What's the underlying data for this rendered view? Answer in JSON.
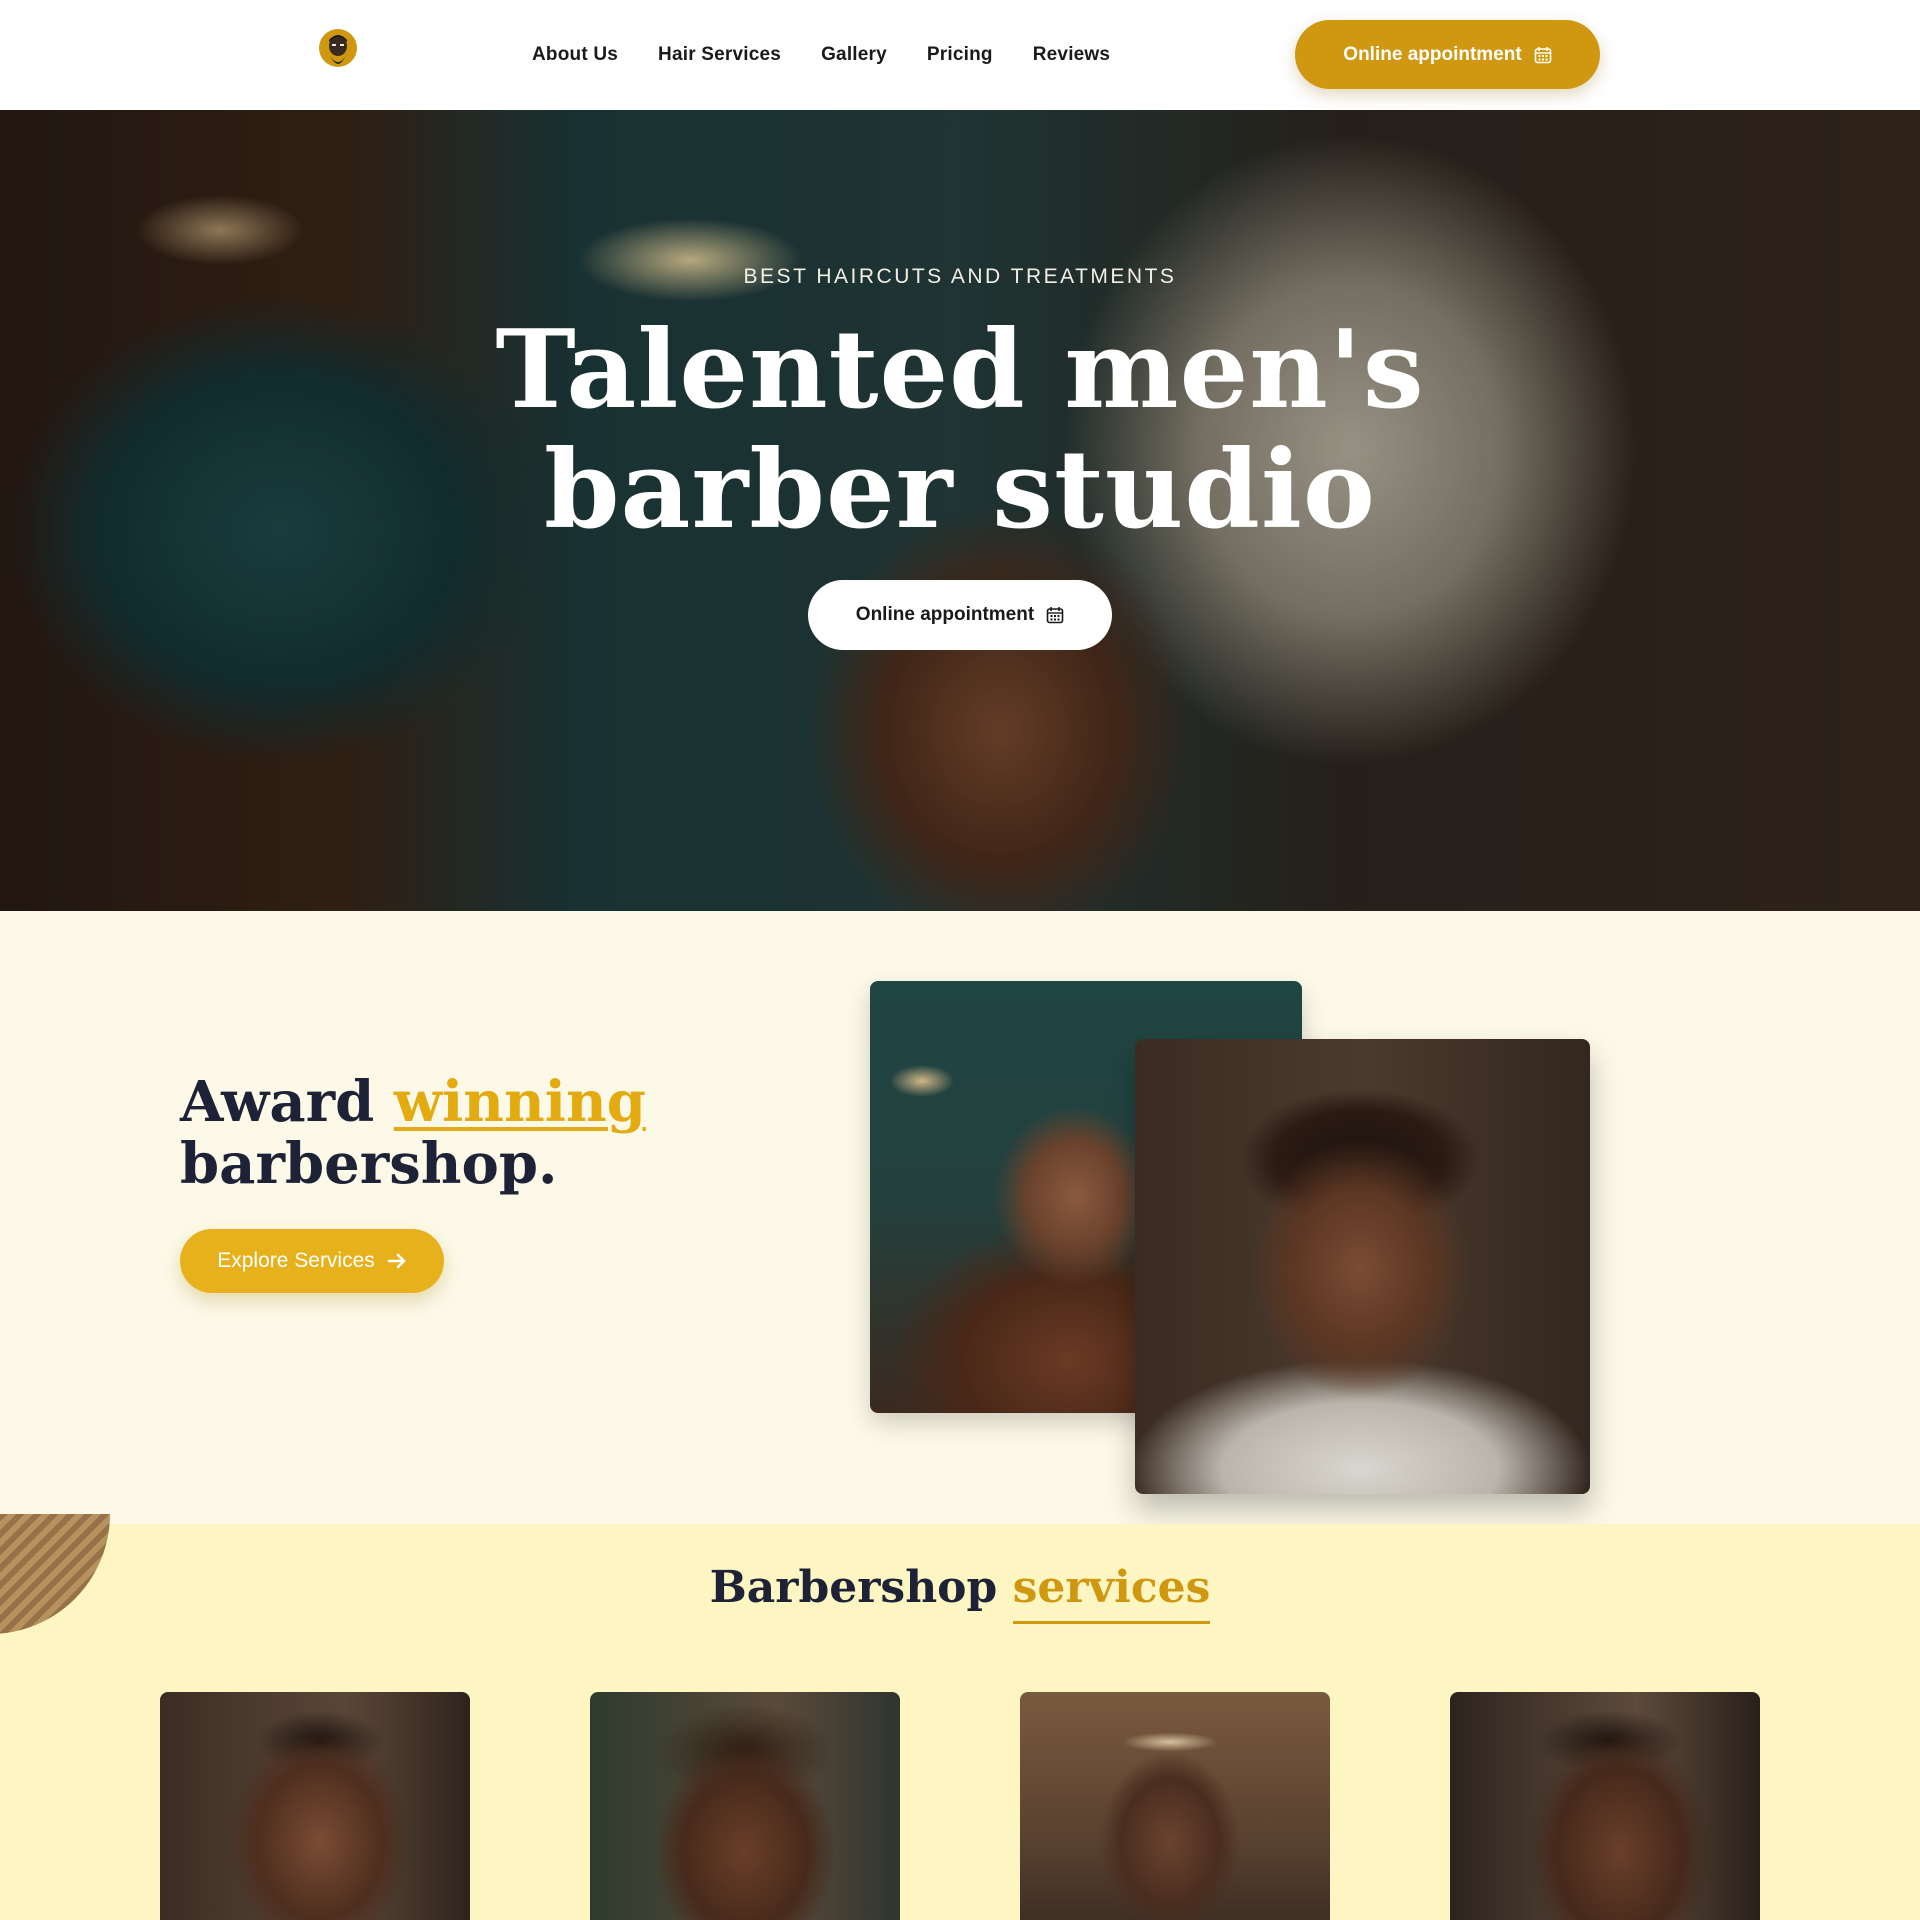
{
  "nav": {
    "logo_icon": "bearded-man-logo-icon",
    "links": [
      "About Us",
      "Hair Services",
      "Gallery",
      "Pricing",
      "Reviews"
    ],
    "cta_label": "Online appointment",
    "cta_icon": "calendar-icon"
  },
  "hero": {
    "eyebrow": "BEST HAIRCUTS AND TREATMENTS",
    "title_line1": "Talented men's",
    "title_line2": "barber studio",
    "cta_label": "Online appointment",
    "cta_icon": "calendar-icon"
  },
  "award": {
    "title_part1": "Award ",
    "title_accent": "winning",
    "title_line2": "barbershop.",
    "button_label": "Explore Services",
    "button_icon": "arrow-right-icon"
  },
  "services": {
    "title_part1": "Barbershop ",
    "title_accent": "services"
  },
  "colors": {
    "accent_gold": "#cf9810",
    "accent_yellow": "#e6b11a",
    "navy_text": "#1d2236",
    "cream_bg": "#fcf9e8",
    "services_bg": "#fdf6c3"
  }
}
